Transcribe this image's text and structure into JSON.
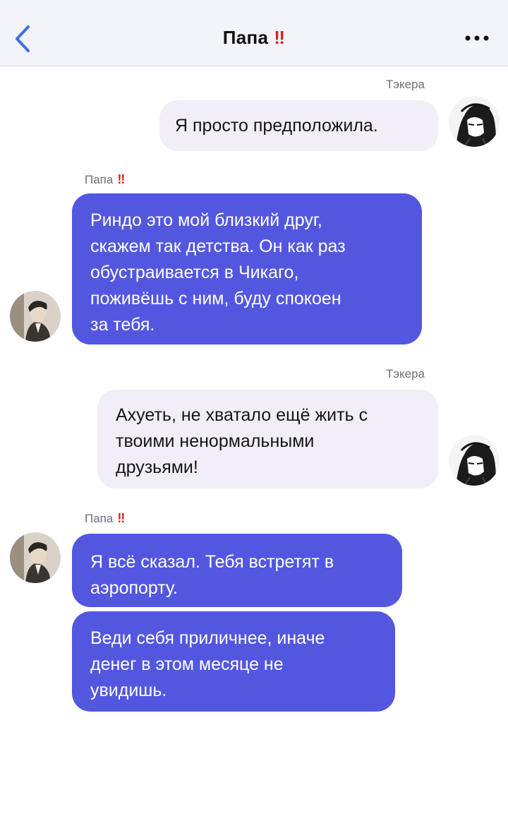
{
  "header": {
    "title": "Папа",
    "title_mark": "‼",
    "back_icon": "chevron-left-icon",
    "more_icon": "more-dots-icon",
    "accent_color": "#3d6fe6",
    "mark_color": "#e0201c"
  },
  "colors": {
    "incoming_bubble": "#5357e0",
    "outgoing_bubble": "#f1eef7"
  },
  "messages": [
    {
      "sender": "Тэкера",
      "direction": "outgoing",
      "text": "Я просто предположила."
    },
    {
      "sender": "Папа",
      "sender_mark": "‼",
      "direction": "incoming",
      "lines": [
        "Риндо это мой близкий друг,",
        "скажем так детства. Он как раз",
        "обустраивается в Чикаго,",
        "поживёшь с ним, буду спокоен",
        "за тебя."
      ]
    },
    {
      "sender": "Тэкера",
      "direction": "outgoing",
      "lines": [
        "Ахуеть, не хватало ещё жить с",
        "твоими ненормальными",
        "друзьями!"
      ]
    },
    {
      "sender": "Папа",
      "sender_mark": "‼",
      "direction": "incoming",
      "lines": [
        "Я всё сказал. Тебя встретят в",
        "аэропорту."
      ]
    },
    {
      "direction": "incoming",
      "lines": [
        "Веди себя приличнее, иначе",
        "денег в этом месяце не",
        "увидишь."
      ]
    }
  ]
}
